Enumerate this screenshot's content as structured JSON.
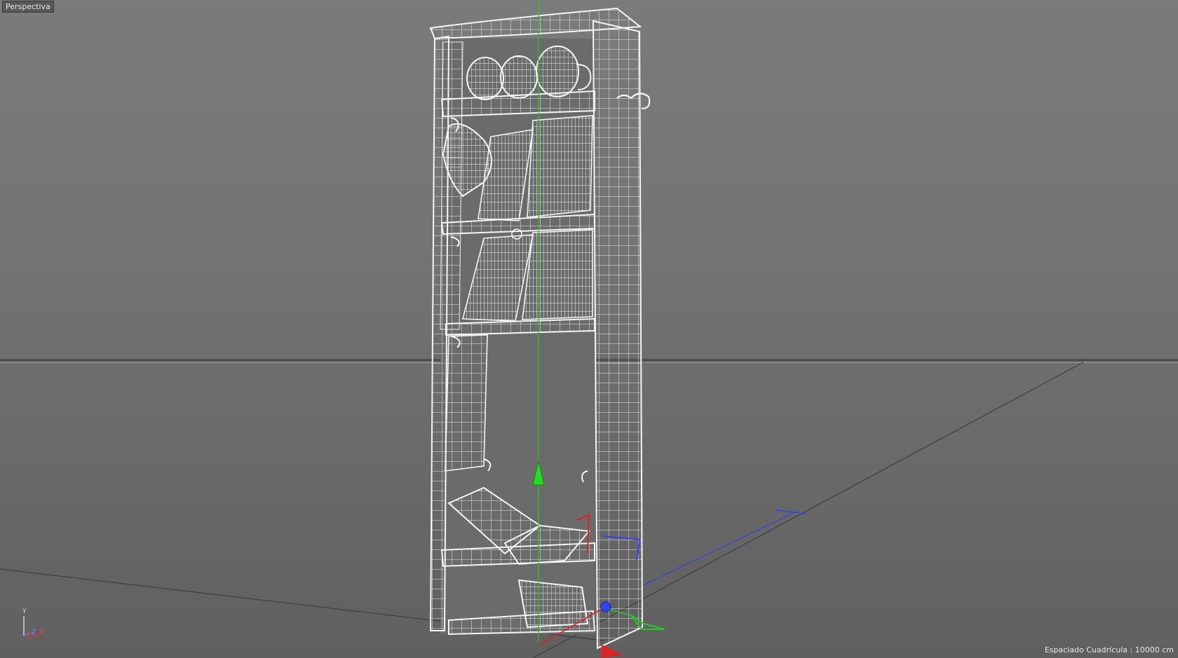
{
  "viewport": {
    "view_name": "Perspectiva",
    "grid_status": "Espaciado Cuadrícula : 10000 cm"
  },
  "axis_gizmo": {
    "y_label": "Y",
    "z_label": "Z",
    "x_label": "X"
  },
  "colors": {
    "background": "#727272",
    "wireframe": "#f2f2f2",
    "horizon": "#4a4a4a",
    "axis_x": "#e02020",
    "axis_y": "#22dd22",
    "axis_z": "#2233ee"
  },
  "scene": {
    "object": "bookshelf-wireframe",
    "shelf_items": [
      "jars",
      "books",
      "books",
      "empty",
      "open-book",
      "paper-stack"
    ]
  }
}
